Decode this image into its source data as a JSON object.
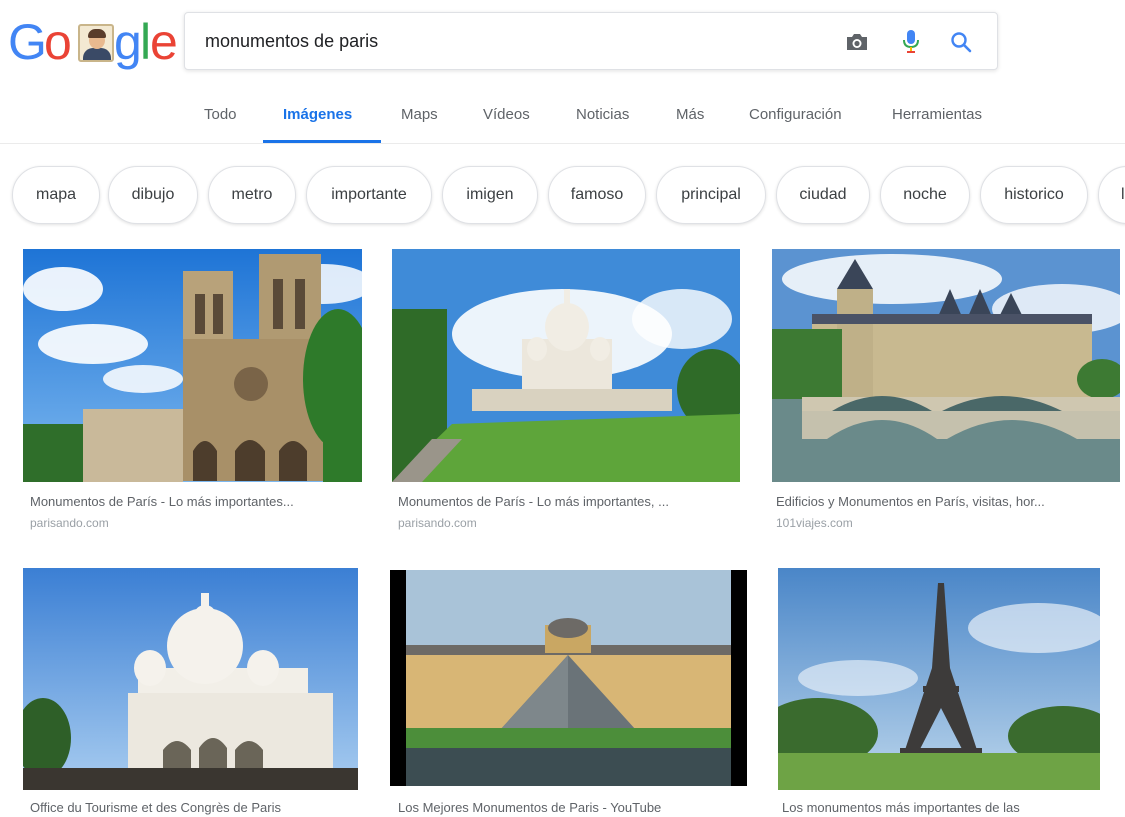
{
  "search": {
    "query": "monumentos de paris"
  },
  "logo": {
    "letters": [
      "G",
      "o",
      "g",
      "l",
      "e"
    ]
  },
  "tabs": [
    {
      "label": "Todo"
    },
    {
      "label": "Imágenes"
    },
    {
      "label": "Maps"
    },
    {
      "label": "Vídeos"
    },
    {
      "label": "Noticias"
    },
    {
      "label": "Más"
    },
    {
      "label": "Configuración"
    },
    {
      "label": "Herramientas"
    }
  ],
  "chips": [
    {
      "label": "mapa"
    },
    {
      "label": "dibujo"
    },
    {
      "label": "metro"
    },
    {
      "label": "importante"
    },
    {
      "label": "imigen"
    },
    {
      "label": "famoso"
    },
    {
      "label": "principal"
    },
    {
      "label": "ciudad"
    },
    {
      "label": "noche"
    },
    {
      "label": "historico"
    },
    {
      "label": "le"
    }
  ],
  "results": [
    {
      "title": "Monumentos de París - Lo más importantes...",
      "source": "parisando.com",
      "subject": "notre-dame"
    },
    {
      "title": "Monumentos de París - Lo más importantes, ...",
      "source": "parisando.com",
      "subject": "sacre-coeur-park"
    },
    {
      "title": "Edificios y Monumentos en París, visitas, hor...",
      "source": "101viajes.com",
      "subject": "conciergerie"
    },
    {
      "title": "Office du Tourisme et des Congrès de Paris",
      "source": "",
      "subject": "sacre-coeur"
    },
    {
      "title": "Los Mejores Monumentos de Paris - YouTube",
      "source": "",
      "subject": "louvre"
    },
    {
      "title": "Los monumentos más importantes de las",
      "source": "",
      "subject": "eiffel-tower"
    }
  ],
  "colors": {
    "accent": "#1a73e8",
    "google_blue": "#4285f4",
    "google_red": "#ea4335",
    "google_yellow": "#fbbc05",
    "google_green": "#34a853"
  },
  "icons": {
    "camera": "camera-icon",
    "mic": "microphone-icon",
    "search": "search-icon"
  }
}
